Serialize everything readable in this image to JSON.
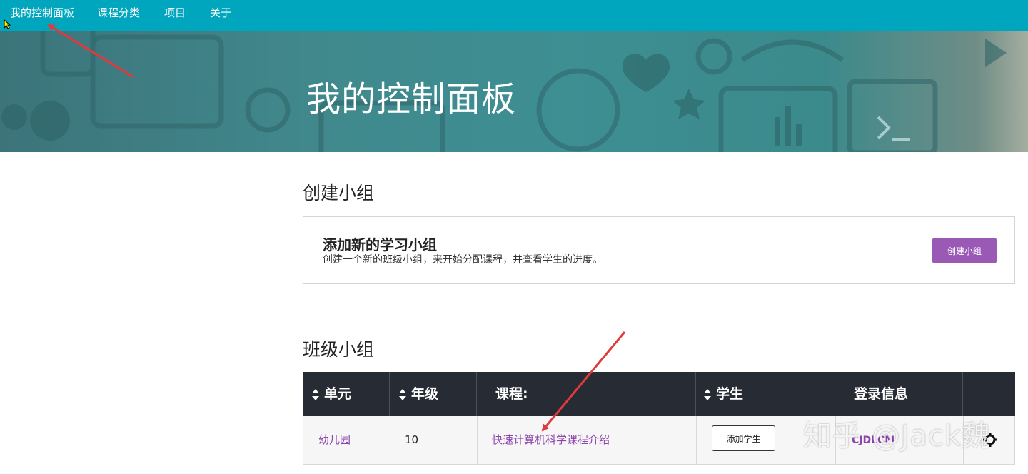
{
  "nav": {
    "items": [
      "我的控制面板",
      "课程分类",
      "项目",
      "关于"
    ]
  },
  "hero": {
    "title": "我的控制面板"
  },
  "create_section": {
    "heading": "创建小组",
    "card_title": "添加新的学习小组",
    "card_desc": "创建一个新的班级小组，来开始分配课程，并查看学生的进度。",
    "button_label": "创建小组"
  },
  "class_section": {
    "heading": "班级小组",
    "columns": [
      "单元",
      "年级",
      "课程:",
      "学生",
      "登录信息"
    ],
    "rows": [
      {
        "unit": "幼儿园",
        "grade": "10",
        "course": "快速计算机科学课程介绍",
        "student_button": "添加学生",
        "login_code": "CJDLCM"
      }
    ]
  },
  "watermark": "知乎 @Jack魏",
  "colors": {
    "nav_bg": "#00a6bd",
    "accent_purple": "#9b59b6",
    "table_header_bg": "#272b33",
    "annotation_arrow": "#e03a3a"
  }
}
